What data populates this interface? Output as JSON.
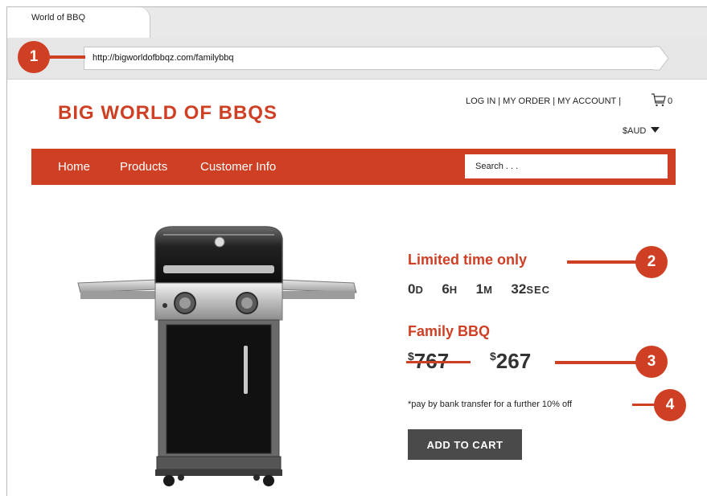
{
  "browser": {
    "tab_title": "World of BBQ",
    "url": "http://bigworldofbbqz.com/familybbq"
  },
  "callouts": [
    "1",
    "2",
    "3",
    "4"
  ],
  "header": {
    "logo": "BIG WORLD OF BBQS",
    "links": [
      "LOG IN",
      "MY ORDER",
      "MY ACCOUNT"
    ],
    "separator": "|",
    "cart_count": "0",
    "currency": "$AUD"
  },
  "nav": {
    "items": [
      "Home",
      "Products",
      "Customer Info"
    ],
    "search_placeholder": "Search . . ."
  },
  "product": {
    "promo_title": "Limited time only",
    "countdown": [
      {
        "value": "0",
        "unit": "D"
      },
      {
        "value": "6",
        "unit": "H"
      },
      {
        "value": "1",
        "unit": "M"
      },
      {
        "value": "32",
        "unit": "SEC"
      }
    ],
    "name": "Family BBQ",
    "currency_symbol": "$",
    "old_price": "767",
    "new_price": "267",
    "note": "*pay by bank transfer for a further 10% off",
    "add_to_cart_label": "ADD TO CART"
  },
  "colors": {
    "brand": "#cf3f24",
    "button": "#4a4a4a"
  },
  "icons": [
    "cart-icon",
    "caret-down-icon",
    "bbq-grill-image"
  ]
}
